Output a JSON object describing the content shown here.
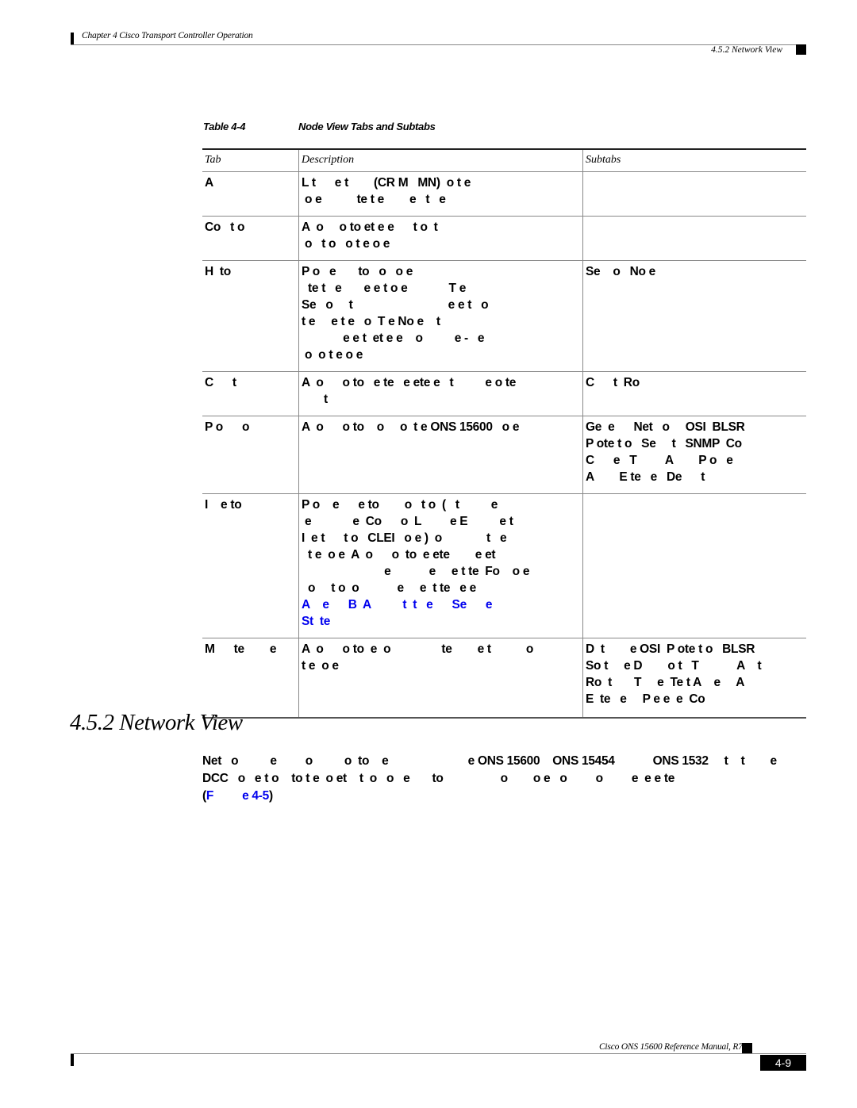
{
  "header": {
    "chapter": "Chapter 4 Cisco Transport Controller Operation",
    "section": "4.5.2  Network View"
  },
  "table": {
    "caption_number": "Table 4-4",
    "caption_title": "Node View Tabs and Subtabs",
    "columns": [
      "Tab",
      "Description",
      "Subtabs"
    ],
    "rows": [
      {
        "tab": "A",
        "description": "L t      e t        (CR M   MN)  o t e\n o e           te t e        e   t   e",
        "subtabs": ""
      },
      {
        "tab": "Co   t o",
        "description": "A  o     o to et e e      t o  t\n o   t o   o t e o e",
        "subtabs": ""
      },
      {
        "tab": "H  to",
        "description": "P o   e       to   o   o e\n  te t   e       e e t o e             T e\nSe   o     t                              e e t   o\nt e     e t e   o  T e No e    t\n             e e t  et e e    o          e -   e\n o  o t e o e",
        "subtabs": "Se    o   No e"
      },
      {
        "tab": "C      t",
        "description": "A  o      o to   e te   e ete e   t          e o te\n       t",
        "subtabs": "C      t  Ro"
      },
      {
        "tab": "P o      o",
        "description": "A  o      o to    o     o  t e ONS 15600   o e",
        "subtabs": "Ge  e      Net   o     OSI  BLSR\nP ote t o   Se     t   SNMP  Co\nC      e   T         A        P o   e\nA        E te   e   De      t"
      },
      {
        "tab": "I    e to",
        "description": "P o    e      e to        o   t o  (   t          e\n e             e  Co      o  L         e E          e t\nI  e t      t o   CLEI   o e )  o              t   e\n  t e  o e  A  o      o  to  e ete        e et\n                          e            e     e t te  Fo    o e\n  o     t o  o            e     e  t te   e e",
        "description_link": "A    e      B  A          t  t   e      Se      e\nSt  te",
        "subtabs": ""
      },
      {
        "tab": "M      te        e",
        "description": "A  o      o to  e  o                te        e t           o\nt e  o e",
        "subtabs": "D  t        e OSI  P ote t o   BLSR\nSo t     e D        o t   T            A    t\nRo  t       T     e  Te t A    e     A\nE  te   e     P e e  e  Co"
      }
    ]
  },
  "section": {
    "title": "4.5.2  Network View",
    "paragraph": "Net   o          e         o          o  to    e                         e ONS 15600    ONS 15454            ONS 1532     t    t        e\nDCC   o   e t o    to t e  o et    t  o   o   e       to                  o        o e   o         o         e  e e te\n(",
    "paragraph_link": "F         e 4-5",
    "paragraph_end": ")"
  },
  "footer": {
    "manual": "Cisco ONS 15600 Reference Manual, R7.2",
    "page": "4-9"
  }
}
